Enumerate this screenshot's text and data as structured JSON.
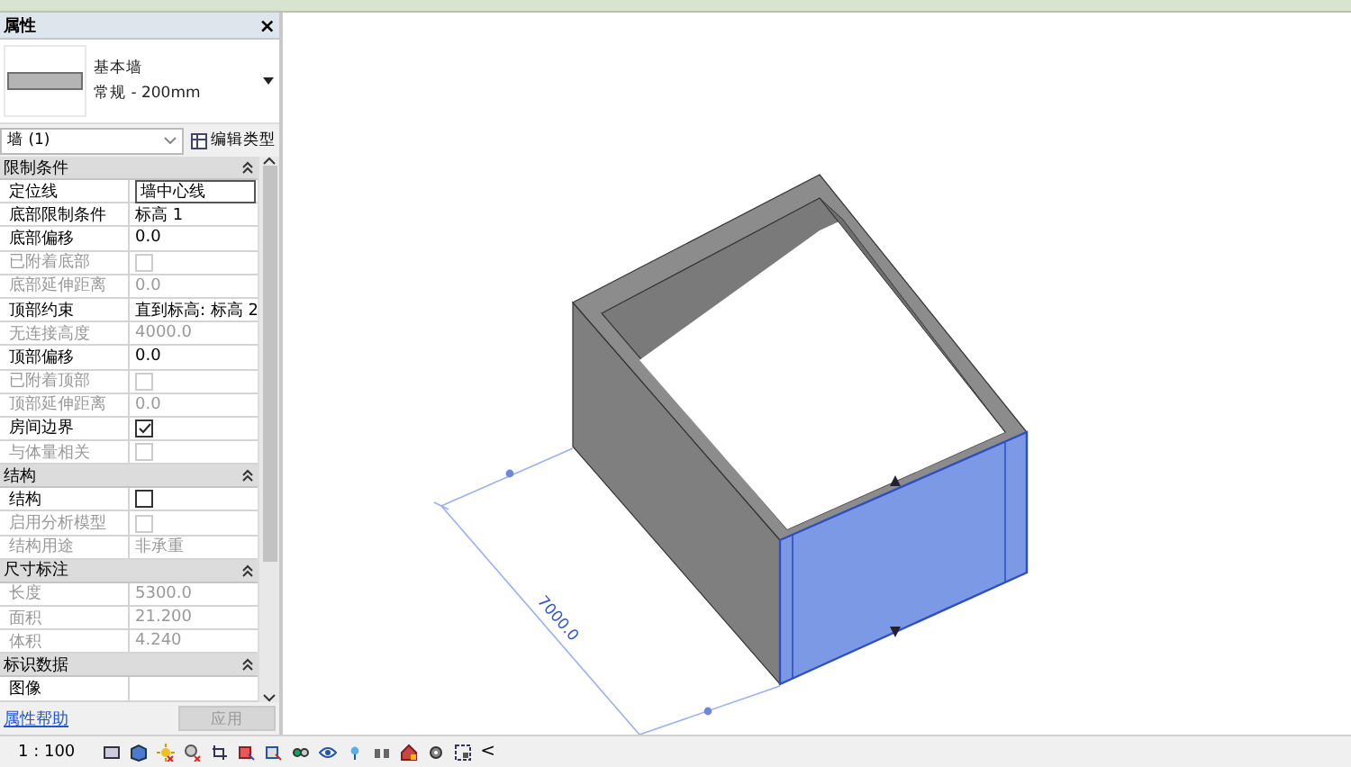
{
  "properties_panel": {
    "title": "属性",
    "close": "×",
    "type_selector": {
      "family": "基本墙",
      "type": "常规 - 200mm"
    },
    "instance_filter": "墙 (1)",
    "edit_type_button": "编辑类型",
    "groups": [
      {
        "title": "限制条件",
        "expanded": true,
        "rows": [
          {
            "label": "定位线",
            "kind": "field",
            "value": "墙中心线",
            "disabled": false
          },
          {
            "label": "底部限制条件",
            "kind": "text",
            "value": "标高 1",
            "disabled": false
          },
          {
            "label": "底部偏移",
            "kind": "text",
            "value": "0.0",
            "disabled": false
          },
          {
            "label": "已附着底部",
            "kind": "checkbox",
            "checked": false,
            "disabled": true
          },
          {
            "label": "底部延伸距离",
            "kind": "text",
            "value": "0.0",
            "disabled": true
          },
          {
            "label": "顶部约束",
            "kind": "text",
            "value": "直到标高: 标高 2",
            "disabled": false
          },
          {
            "label": "无连接高度",
            "kind": "text",
            "value": "4000.0",
            "disabled": true
          },
          {
            "label": "顶部偏移",
            "kind": "text",
            "value": "0.0",
            "disabled": false
          },
          {
            "label": "已附着顶部",
            "kind": "checkbox",
            "checked": false,
            "disabled": true
          },
          {
            "label": "顶部延伸距离",
            "kind": "text",
            "value": "0.0",
            "disabled": true
          },
          {
            "label": "房间边界",
            "kind": "checkbox",
            "checked": true,
            "disabled": false
          },
          {
            "label": "与体量相关",
            "kind": "checkbox",
            "checked": false,
            "disabled": true
          }
        ]
      },
      {
        "title": "结构",
        "expanded": true,
        "rows": [
          {
            "label": "结构",
            "kind": "checkbox",
            "checked": false,
            "disabled": false
          },
          {
            "label": "启用分析模型",
            "kind": "checkbox",
            "checked": false,
            "disabled": true
          },
          {
            "label": "结构用途",
            "kind": "text",
            "value": "非承重",
            "disabled": true
          }
        ]
      },
      {
        "title": "尺寸标注",
        "expanded": true,
        "rows": [
          {
            "label": "长度",
            "kind": "text",
            "value": "5300.0",
            "disabled": true
          },
          {
            "label": "面积",
            "kind": "text",
            "value": "21.200",
            "disabled": true
          },
          {
            "label": "体积",
            "kind": "text",
            "value": "4.240",
            "disabled": true
          }
        ]
      },
      {
        "title": "标识数据",
        "expanded": true,
        "rows": [
          {
            "label": "图像",
            "kind": "text",
            "value": "",
            "disabled": false
          }
        ]
      }
    ],
    "help_link": "属性帮助",
    "apply_button": {
      "label": "应用",
      "disabled": true
    }
  },
  "viewport": {
    "dimension": "7000.0"
  },
  "status_bar": {
    "scale": "1 : 100",
    "collapse": "<"
  }
}
